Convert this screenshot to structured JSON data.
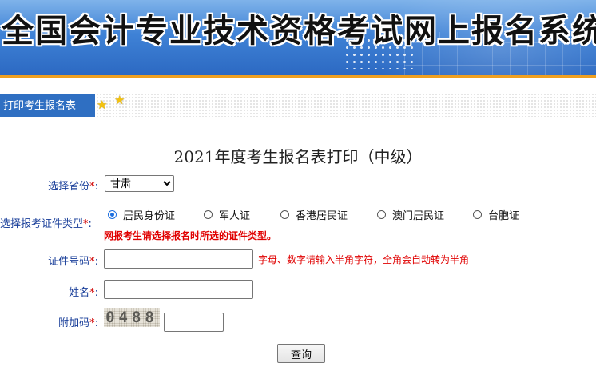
{
  "header": {
    "title": "全国会计专业技术资格考试网上报名系统"
  },
  "tabs": [
    {
      "label": "打印考生报名表"
    }
  ],
  "icons": {
    "decor": [
      "star-icon",
      "star-icon"
    ]
  },
  "colors": {
    "tab_bg": "#2f6fc2",
    "required": "#d00000",
    "label": "#1a3f9a",
    "accent_line": "#f0a020"
  },
  "form": {
    "title": "2021年度考生报名表打印（中级）",
    "province": {
      "label": "选择省份",
      "required_mark": "*",
      "colon": ":",
      "selected": "甘肃"
    },
    "id_type": {
      "label": "选择报考证件类型",
      "required_mark": "*",
      "colon": ":",
      "options": [
        "居民身份证",
        "军人证",
        "香港居民证",
        "澳门居民证",
        "台胞证"
      ],
      "selected": "居民身份证",
      "warning": "网报考生请选择报名时所选的证件类型。"
    },
    "id_number": {
      "label": "证件号码",
      "required_mark": "*",
      "colon": ":",
      "value": "",
      "hint": "字母、数字请输入半角字符，全角会自动转为半角"
    },
    "name": {
      "label": "姓名",
      "required_mark": "*",
      "colon": ":",
      "value": ""
    },
    "captcha": {
      "label": "附加码",
      "required_mark": "*",
      "colon": ":",
      "image_text": "0488",
      "value": ""
    },
    "submit_label": "查询"
  }
}
